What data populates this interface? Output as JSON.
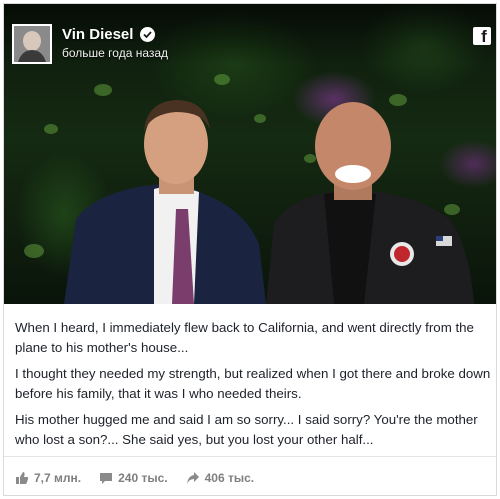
{
  "post": {
    "author": "Vin Diesel",
    "time": "больше года назад",
    "paragraphs": [
      "When I heard, I immediately flew back to California, and went directly from the plane to his mother's house...",
      "I thought they needed my strength, but realized when I got there and broke down before his family, that it was I who needed theirs.",
      "His mother hugged me and said I am so sorry... I said sorry? You're the mother who lost a son?... She said yes, but you lost your other half..."
    ]
  },
  "stats": {
    "likes": "7,7 млн.",
    "comments": "240 тыс.",
    "shares": "406 тыс."
  },
  "icons": {
    "verified": "verified-check-icon",
    "platform": "facebook-logo-icon",
    "like": "thumbs-up-icon",
    "comment": "comment-bubble-icon",
    "share": "share-arrow-icon"
  },
  "colors": {
    "text": "#1d2129",
    "muted": "#7f7f7f",
    "border": "#d9d9d9"
  }
}
